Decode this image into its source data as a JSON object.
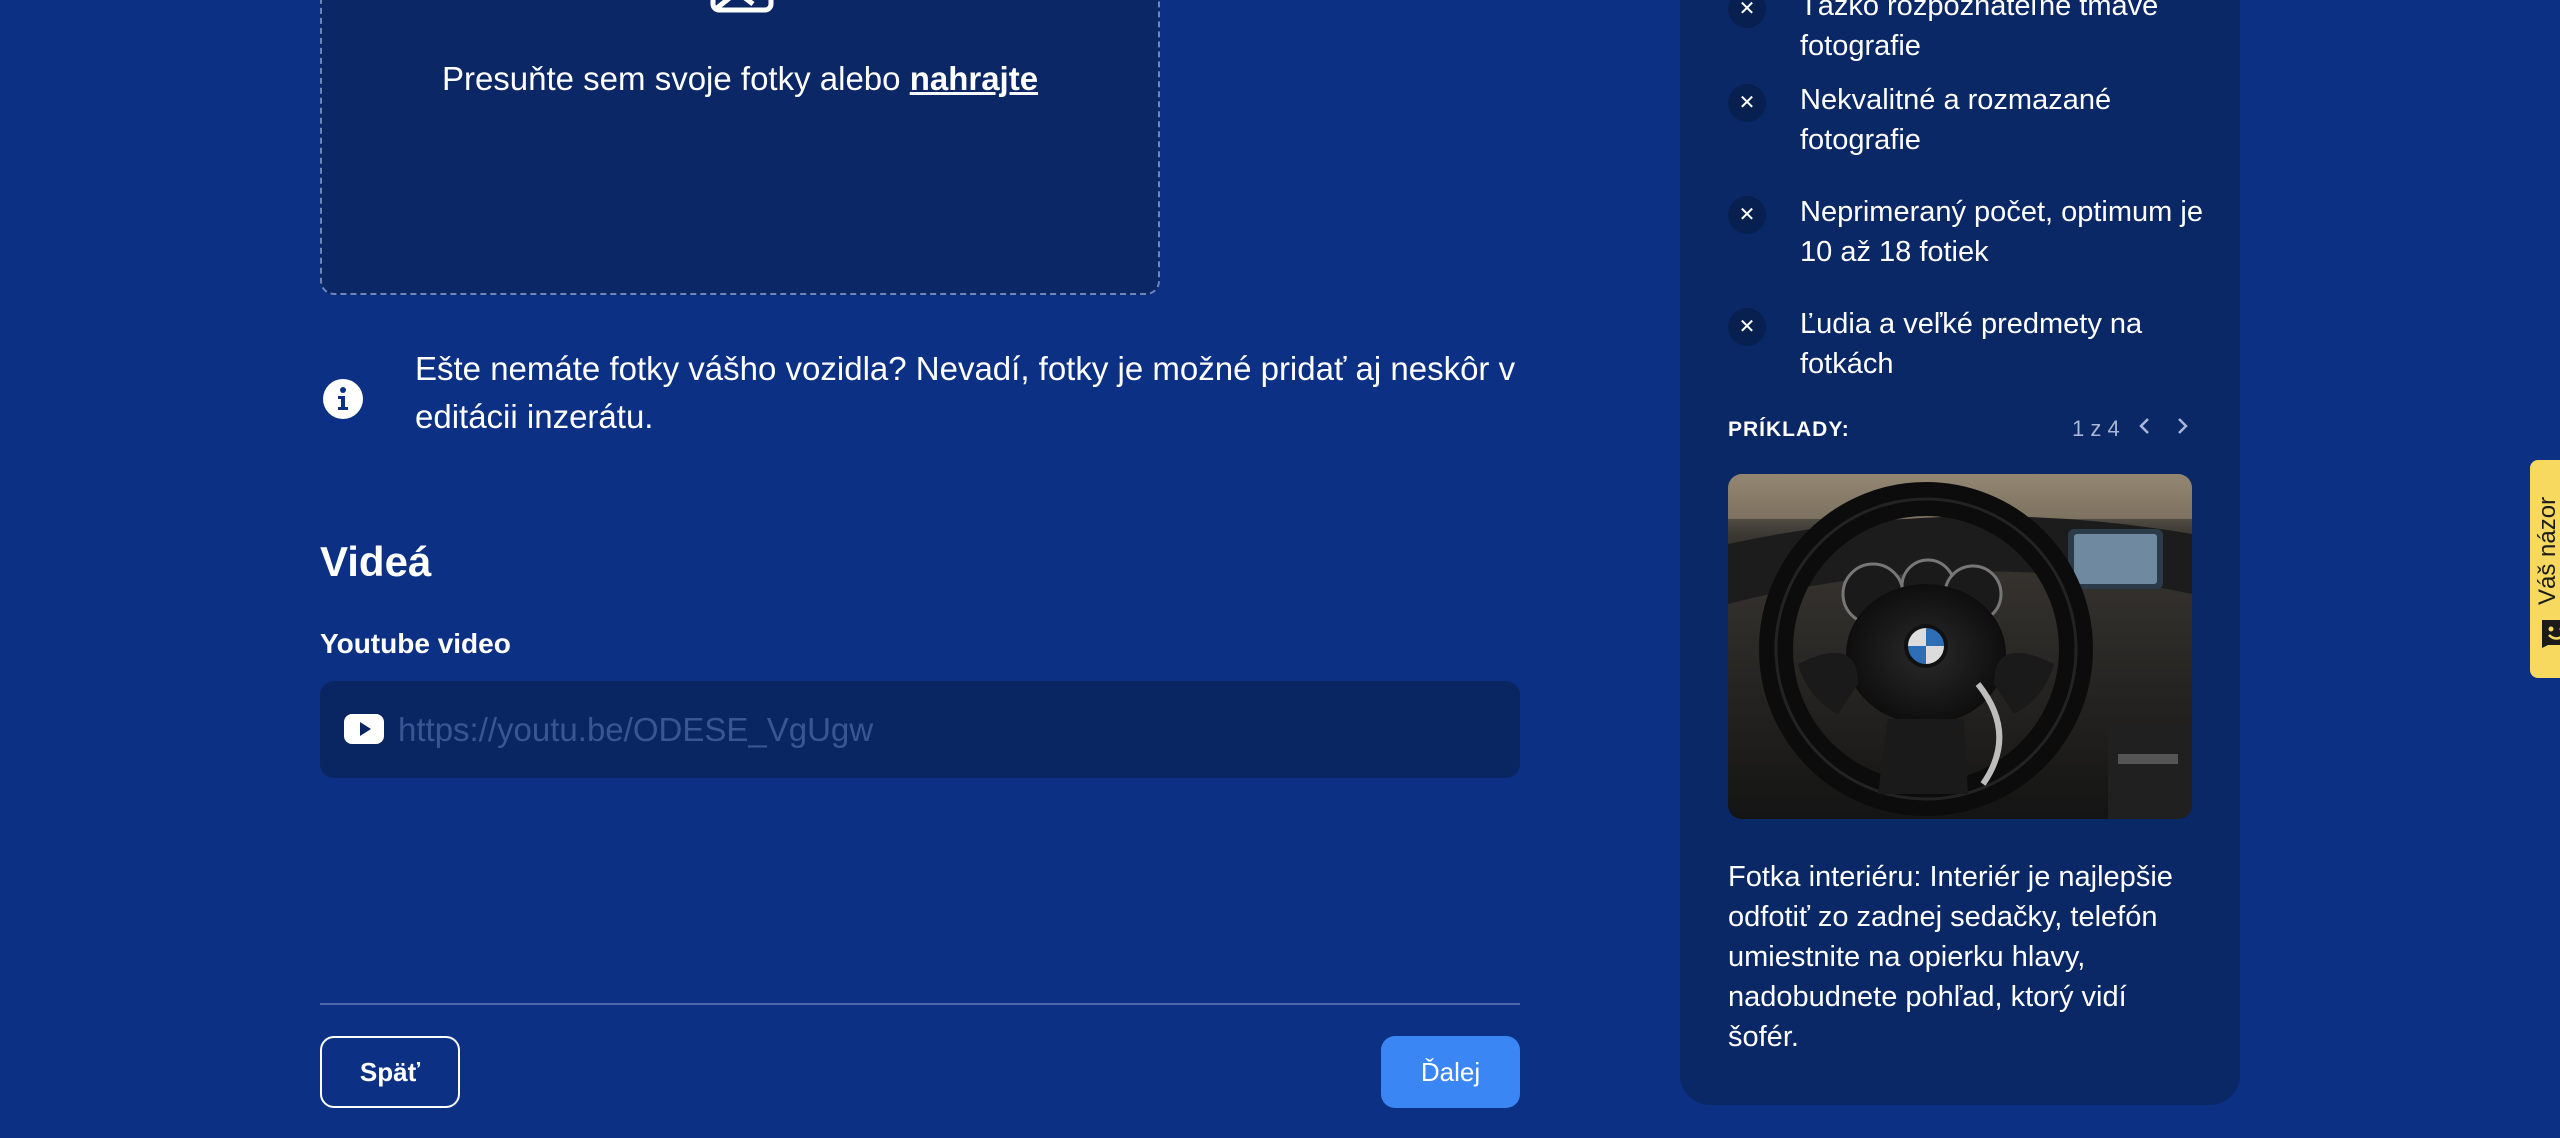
{
  "upload": {
    "drop_text": "Presuňte sem svoje fotky alebo",
    "upload_link": "nahrajte"
  },
  "info": {
    "text": "Ešte nemáte fotky vášho vozidla? Nevadí, fotky je možné pridať aj neskôr v editácii inzerátu."
  },
  "videos": {
    "title": "Videá",
    "youtube_label": "Youtube video",
    "youtube_placeholder": "https://youtu.be/ODESE_VgUgw",
    "youtube_value": ""
  },
  "nav": {
    "back_label": "Späť",
    "next_label": "Ďalej"
  },
  "tips_panel": {
    "tips": [
      {
        "text": "Ťažko rozpoznateľné tmavé fotografie"
      },
      {
        "text": "Nekvalitné a rozmazané fotografie"
      },
      {
        "text": "Neprimeraný počet, optimum je 10 až 18 fotiek"
      },
      {
        "text": "Ľudia a veľké predmety na fotkách"
      }
    ],
    "examples_label": "PRÍKLADY:",
    "pager": "1 z 4",
    "example_caption": "Fotka interiéru: Interiér je najlepšie odfotiť zo zadnej sedačky, telefón umiestnite na opierku hlavy, nadobudnete pohľad, ktorý vidí šofér."
  },
  "feedback": {
    "label": "Váš názor"
  },
  "colors": {
    "background": "#0c3184",
    "panel": "#0a2766",
    "accent": "#3b86f5",
    "feedback": "#f6d95e"
  },
  "icons": [
    "image-icon",
    "info-icon",
    "youtube-icon",
    "close-icon",
    "chevron-left-icon",
    "chevron-right-icon",
    "smile-icon"
  ]
}
